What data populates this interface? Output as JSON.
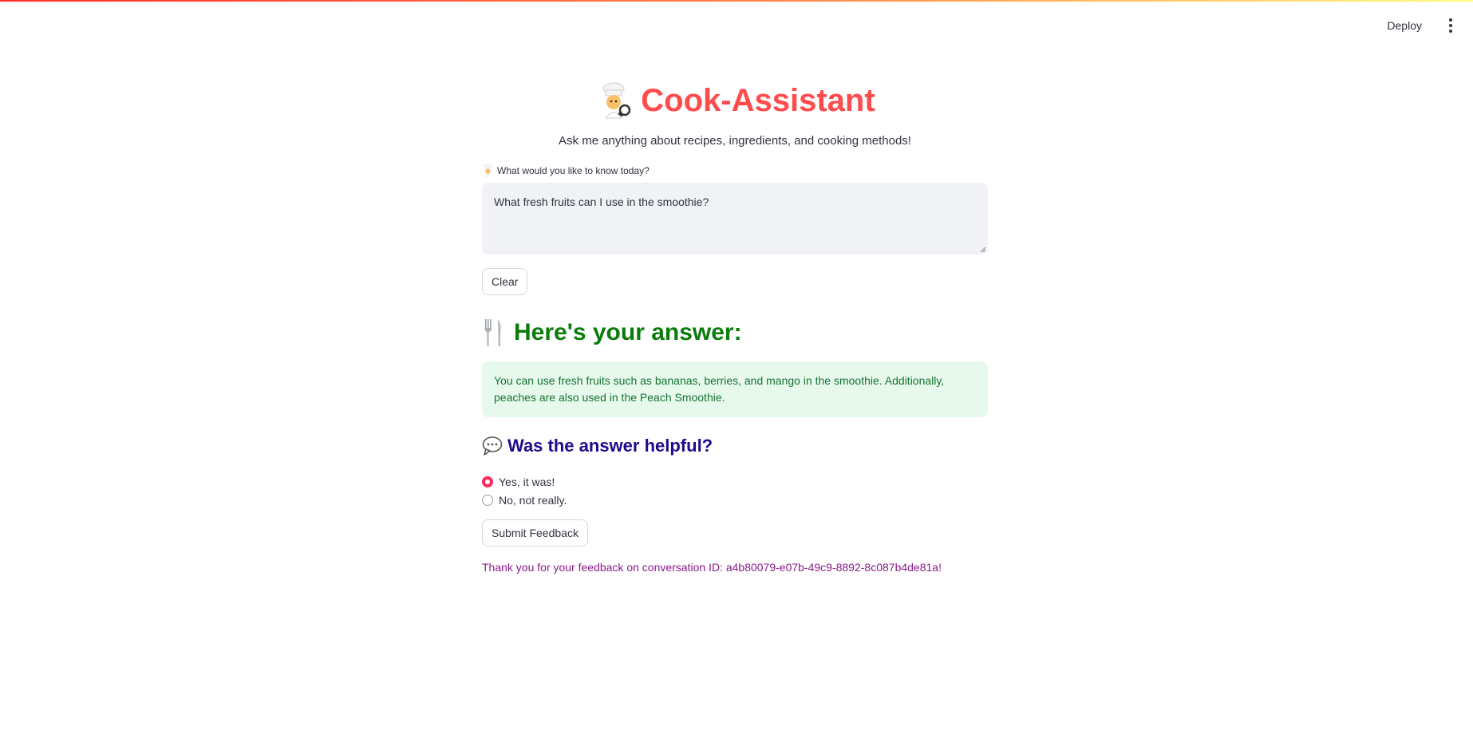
{
  "toolbar": {
    "deploy_label": "Deploy",
    "menu_icon": "more-vertical-icon"
  },
  "header": {
    "title": "Cook-Assistant",
    "title_icon": "chef-icon",
    "subtitle": "Ask me anything about recipes, ingredients, and cooking methods!"
  },
  "question": {
    "label": "What would you like to know today?",
    "label_icon": "chef-icon",
    "value": "What fresh fruits can I use in the smoothie?",
    "clear_label": "Clear"
  },
  "answer": {
    "heading": "Here's your answer:",
    "heading_icon": "cutlery-icon",
    "text": "You can use fresh fruits such as bananas, berries, and mango in the smoothie. Additionally, peaches are also used in the Peach Smoothie."
  },
  "feedback": {
    "heading": "Was the answer helpful?",
    "heading_icon": "speech-bubble-icon",
    "options": [
      {
        "label": "Yes, it was!",
        "selected": true
      },
      {
        "label": "No, not really.",
        "selected": false
      }
    ],
    "submit_label": "Submit Feedback",
    "thanks_message": "Thank you for your feedback on conversation ID: a4b80079-e07b-49c9-8892-8c087b4de81a!"
  },
  "colors": {
    "title": "#ff4b4b",
    "answer_heading": "#0a7c0a",
    "answer_box_bg": "#e6f9ec",
    "answer_text": "#177233",
    "feedback_heading": "#1e0a8c",
    "radio_selected": "#ff2b5c",
    "thanks_text": "#8b1a8b"
  }
}
